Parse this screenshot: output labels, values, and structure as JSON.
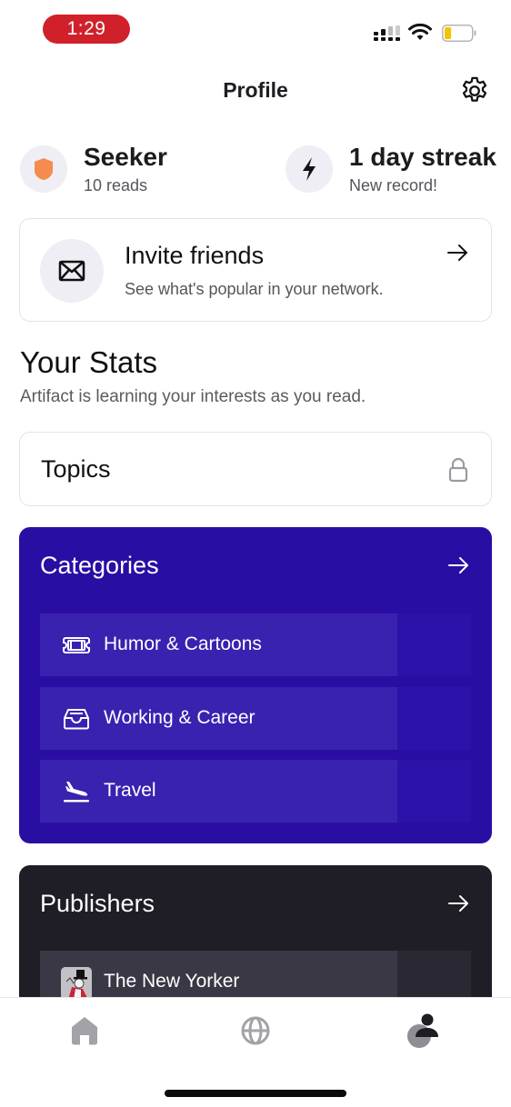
{
  "status_bar": {
    "time": "1:29",
    "time_pill_color": "#d0212a",
    "icons": [
      "cellular-signal-icon",
      "wifi-icon",
      "battery-low-icon"
    ],
    "battery_level": 0.25
  },
  "header": {
    "title": "Profile",
    "settings_icon": "gear-icon"
  },
  "badges": [
    {
      "title": "Seeker",
      "subtitle": "10 reads",
      "icon": "shield-icon",
      "icon_color": "#f58b4c"
    },
    {
      "title": "1 day streak",
      "subtitle": "New record!",
      "icon": "lightning-bolt-icon"
    }
  ],
  "invite": {
    "title": "Invite friends",
    "subtitle": "See what's popular in your network.",
    "icon": "envelope-icon",
    "action_icon": "arrow-right-icon"
  },
  "stats": {
    "title": "Your Stats",
    "subtitle": "Artifact is learning your interests as you read.",
    "topics": {
      "label": "Topics",
      "icon": "lock-icon",
      "locked": true
    }
  },
  "categories": {
    "title": "Categories",
    "color": "#2a0ea3",
    "items": [
      {
        "label": "Humor & Cartoons",
        "icon": "ticket-icon",
        "fraction": 0.83
      },
      {
        "label": "Working & Career",
        "icon": "inbox-tray-icon",
        "fraction": 0.83
      },
      {
        "label": "Travel",
        "icon": "airplane-landing-icon",
        "fraction": 0.83
      }
    ]
  },
  "publishers": {
    "title": "Publishers",
    "color": "#1f1d26",
    "items": [
      {
        "label": "The New Yorker",
        "icon": "publisher-logo",
        "fraction": 0.83
      }
    ]
  },
  "bottom_nav": {
    "items": [
      {
        "name": "home",
        "icon": "home-icon",
        "active": false
      },
      {
        "name": "discover",
        "icon": "globe-icon",
        "active": false
      },
      {
        "name": "profile",
        "icon": "profile-icon",
        "active": true
      }
    ]
  }
}
